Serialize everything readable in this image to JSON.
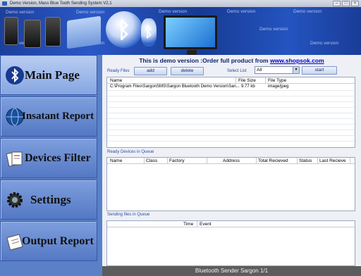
{
  "window": {
    "title": "Demo Version, Mass Blue Tooth Sending System V2.1"
  },
  "banner": {
    "watermark": "Demo version"
  },
  "sidebar": {
    "items": [
      {
        "label": "Main Page",
        "icon": "bluetooth-icon"
      },
      {
        "label": "Insatant Report",
        "icon": "globe-icon"
      },
      {
        "label": "Devices Filter",
        "icon": "documents-icon"
      },
      {
        "label": "Settings",
        "icon": "gear-icon"
      },
      {
        "label": "Output Report",
        "icon": "notepad-icon"
      }
    ]
  },
  "main": {
    "demo_text": "This is demo version :Order full product from",
    "demo_link": "www.shopsok.com",
    "ready_files_label": "Ready Files",
    "add_label": "add",
    "delete_label": "delete",
    "select_list_label": "Select List",
    "select_value": "All",
    "start_label": "start",
    "files": {
      "columns": [
        "Name",
        "File Size",
        "File Type"
      ],
      "rows": [
        {
          "name": "C:\\Program Files\\SargonSMS\\Sargon Bluetooth Demo Version\\San...",
          "size": "9.77 kb",
          "type": "image/jpeg"
        }
      ]
    },
    "ready_devices_label": "Ready Devices in Queue",
    "devices": {
      "columns": [
        "Name",
        "Class",
        "Factory",
        "Address",
        "Total Recieved",
        "Status",
        "Last Recieve"
      ]
    },
    "sending_label": "Sending files in Queue",
    "sending": {
      "columns": [
        "Time",
        "Event"
      ]
    }
  },
  "status": {
    "text": "Bluetooth Sender Sargon 1/1"
  }
}
